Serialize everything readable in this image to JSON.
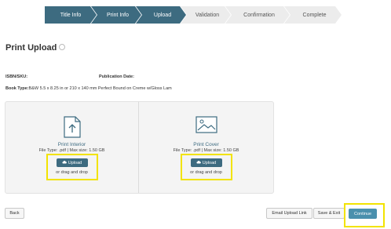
{
  "wizard": {
    "steps": [
      {
        "label": "Title Info",
        "status": "complete"
      },
      {
        "label": "Print Info",
        "status": "complete"
      },
      {
        "label": "Upload",
        "status": "current"
      },
      {
        "label": "Validation",
        "status": "pending"
      },
      {
        "label": "Confirmation",
        "status": "pending"
      },
      {
        "label": "Complete",
        "status": "pending"
      }
    ]
  },
  "page": {
    "title": "Print Upload",
    "isbn_label": "ISBN/SKU:",
    "publication_date_label": "Publication Date:",
    "book_type_label": "Book Type:",
    "book_type_value": "B&W 5.5 x 8.25 in or 210 x 140 mm Perfect Bound on Creme w/Gloss Lam"
  },
  "uploads": {
    "interior": {
      "title": "Print Interior",
      "file_info": "File Type: .pdf | Max size: 1.50 GB",
      "button_label": "Upload",
      "drag_text": "or drag and drop",
      "icon": "file-upload-icon"
    },
    "cover": {
      "title": "Print Cover",
      "file_info": "File Type: .pdf | Max size: 1.50 GB",
      "button_label": "Upload",
      "drag_text": "or drag and drop",
      "icon": "image-icon"
    }
  },
  "footer": {
    "back_label": "Back",
    "email_label": "Email Upload Link",
    "save_exit_label": "Save & Exit",
    "continue_label": "Continue"
  },
  "colors": {
    "primary": "#3d6b80",
    "continue": "#4a90ad",
    "highlight": "#f2e300"
  }
}
